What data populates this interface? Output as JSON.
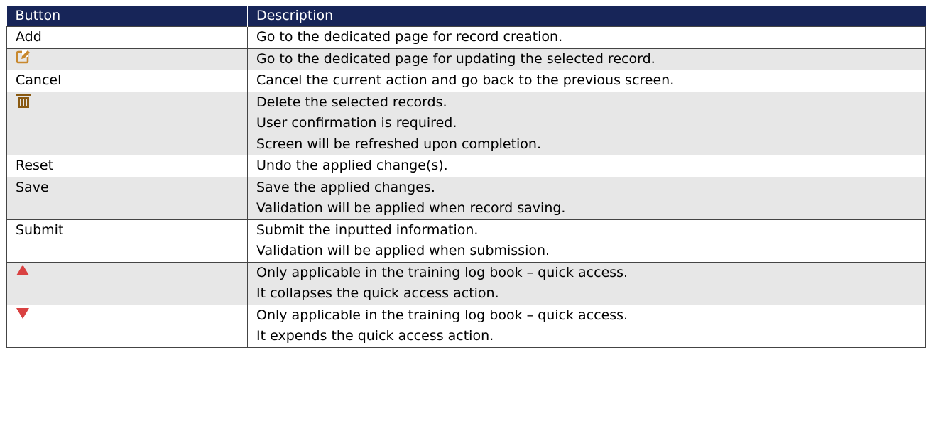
{
  "table": {
    "headers": {
      "button": "Button",
      "description": "Description"
    },
    "rows": [
      {
        "button": "Add",
        "lines": [
          "Go to the dedicated page for record creation."
        ]
      },
      {
        "icon": "edit-icon",
        "lines": [
          "Go to the dedicated page for updating the selected record."
        ]
      },
      {
        "button": "Cancel",
        "lines": [
          "Cancel the current action and go back to the previous screen."
        ]
      },
      {
        "icon": "trash-icon",
        "lines": [
          "Delete the selected records.",
          "User confirmation is required.",
          "Screen will be refreshed upon completion."
        ]
      },
      {
        "button": "Reset",
        "lines": [
          "Undo the applied change(s)."
        ]
      },
      {
        "button": "Save",
        "lines": [
          "Save the applied changes.",
          "Validation will be applied when record saving."
        ]
      },
      {
        "button": "Submit",
        "lines": [
          "Submit the inputted information.",
          "Validation will be applied when submission."
        ]
      },
      {
        "icon": "triangle-up-icon",
        "lines": [
          "Only applicable in the training log book – quick access.",
          "It collapses the quick access action."
        ]
      },
      {
        "icon": "triangle-down-icon",
        "lines": [
          "Only applicable in the training log book – quick access.",
          "It expends the quick access action."
        ]
      }
    ]
  },
  "colors": {
    "header_bg": "#172558",
    "header_text": "#ffffff",
    "row_alt_bg": "#e7e7e7",
    "edit_icon": "#c8882e",
    "trash_icon": "#8a5a12",
    "triangle_icon": "#d94141"
  }
}
